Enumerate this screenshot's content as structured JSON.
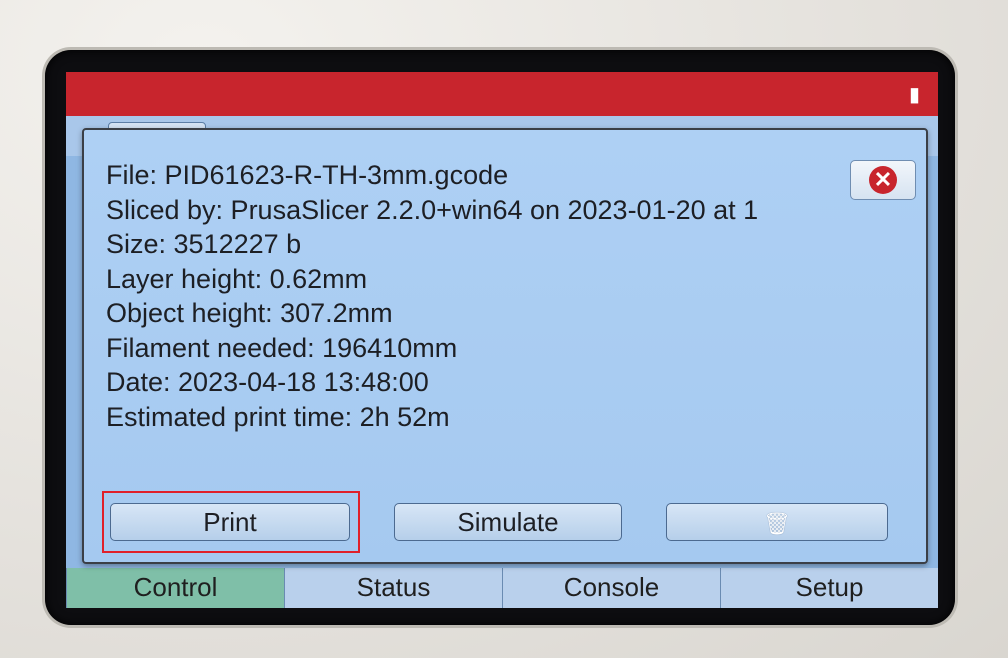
{
  "background_app": {
    "tabs": [
      "Control",
      "Status",
      "Console",
      "Setup"
    ]
  },
  "dialog": {
    "lines": [
      "File: PID61623-R-TH-3mm.gcode",
      "Sliced by: PrusaSlicer 2.2.0+win64 on 2023-01-20 at 1",
      "Size: 3512227 b",
      "Layer height: 0.62mm",
      "Object height: 307.2mm",
      "Filament needed: 196410mm",
      "Date: 2023-04-18 13:48:00",
      "Estimated print time: 2h 52m"
    ],
    "buttons": {
      "print": "Print",
      "simulate": "Simulate",
      "delete_icon": "trash-icon",
      "close_icon": "close-icon"
    }
  },
  "colors": {
    "screen_bg": "#8fb7e3",
    "titlebar": "#c8252d",
    "highlight_frame": "#e0202a"
  }
}
